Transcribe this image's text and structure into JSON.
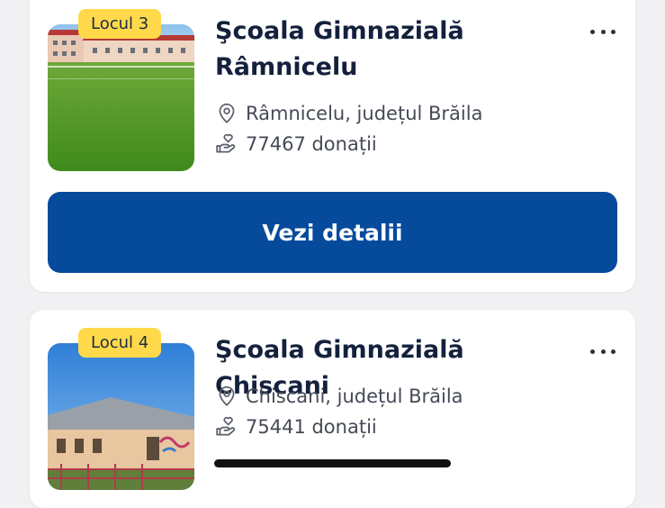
{
  "cards": [
    {
      "rank_label": "Locul 3",
      "title_line1": "Şcoala Gimnazială",
      "title_line2": "Râmnicelu",
      "location": "Râmnicelu, județul Brăila",
      "donations": "77467 donații",
      "cta_label": "Vezi detalii",
      "image": "school-building-with-green-sports-field"
    },
    {
      "rank_label": "Locul 4",
      "title": "Şcoala Gimnazială Chiscani",
      "location": "Chiscani, județul Brăila",
      "donations": "75441 donații",
      "image": "school-building-under-blue-sky"
    }
  ],
  "icons": {
    "menu": "more-dots-icon",
    "location": "location-pin-icon",
    "donations": "hand-heart-icon"
  },
  "colors": {
    "badge": "#ffd94a",
    "primary_button": "#064a9c",
    "title_text": "#14213d",
    "meta_text": "#454a56"
  }
}
